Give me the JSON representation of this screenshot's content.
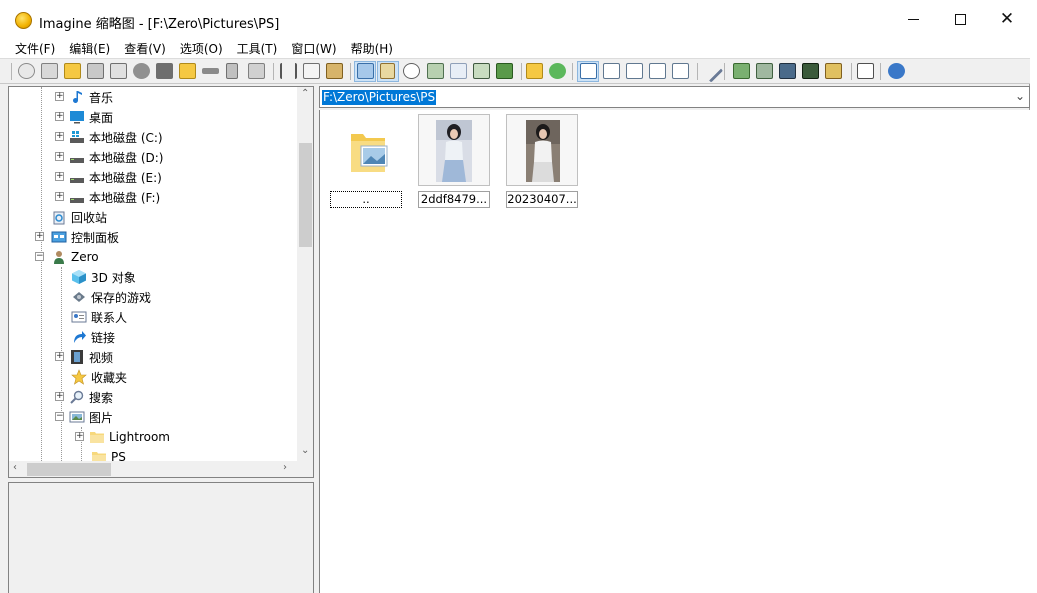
{
  "window": {
    "title": "Imagine 缩略图 - [F:\\Zero\\Pictures\\PS]",
    "minimize": "",
    "maximize": "",
    "close": "✕"
  },
  "menu": [
    "文件(F)",
    "编辑(E)",
    "查看(V)",
    "选项(O)",
    "工具(T)",
    "窗口(W)",
    "帮助(H)"
  ],
  "toolbar": {
    "icons": [
      "view-icon",
      "browse-icon",
      "open-folder-icon",
      "save-icon",
      "print-icon",
      "info-icon",
      "camera-icon",
      "folder-star-icon",
      "rename-icon",
      "trash-icon",
      "properties-icon",
      "cut-icon",
      "copy-icon",
      "paste-icon",
      "thumbnail-view-icon",
      "filmstrip-icon",
      "clock-icon",
      "thumb-small-icon",
      "thumb-grid-icon",
      "thumb-frame-icon",
      "thumb-image-icon",
      "up-folder-icon",
      "refresh-icon",
      "large-icons-icon",
      "small-icons-icon",
      "list-icon",
      "details-icon",
      "report-icon",
      "wrench-icon",
      "batch-convert-icon",
      "batch-settings-icon",
      "slideshow-icon",
      "film-icon",
      "edit-icon",
      "pencil-icon",
      "help-icon"
    ]
  },
  "tree": {
    "items": [
      {
        "label": "音乐",
        "icon": "music-note-icon"
      },
      {
        "label": "桌面",
        "icon": "desktop-icon"
      },
      {
        "label": "本地磁盘 (C:)",
        "icon": "system-drive-icon"
      },
      {
        "label": "本地磁盘 (D:)",
        "icon": "drive-icon"
      },
      {
        "label": "本地磁盘 (E:)",
        "icon": "drive-icon"
      },
      {
        "label": "本地磁盘 (F:)",
        "icon": "drive-icon"
      },
      {
        "label": "回收站",
        "icon": "recycle-bin-icon"
      },
      {
        "label": "控制面板",
        "icon": "control-panel-icon"
      },
      {
        "label": "Zero",
        "icon": "user-icon"
      },
      {
        "label": "3D 对象",
        "icon": "cube-3d-icon"
      },
      {
        "label": "保存的游戏",
        "icon": "saved-games-icon"
      },
      {
        "label": "联系人",
        "icon": "contacts-icon"
      },
      {
        "label": "链接",
        "icon": "link-arrow-icon"
      },
      {
        "label": "视频",
        "icon": "video-icon"
      },
      {
        "label": "收藏夹",
        "icon": "star-icon"
      },
      {
        "label": "搜索",
        "icon": "search-icon"
      },
      {
        "label": "图片",
        "icon": "pictures-icon"
      },
      {
        "label": "Lightroom",
        "icon": "folder-icon"
      },
      {
        "label": "PS",
        "icon": "folder-icon"
      }
    ]
  },
  "address": {
    "path": "F:\\Zero\\Pictures\\PS"
  },
  "thumbnails": [
    {
      "label": "..",
      "kind": "parent-folder"
    },
    {
      "label": "2ddf8479...",
      "kind": "photo"
    },
    {
      "label": "20230407...",
      "kind": "photo"
    }
  ]
}
